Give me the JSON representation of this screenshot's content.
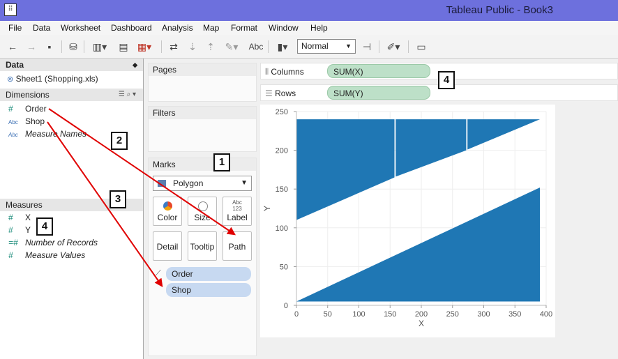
{
  "window": {
    "title": "Tableau Public - Book3"
  },
  "menu": [
    "File",
    "Data",
    "Worksheet",
    "Dashboard",
    "Analysis",
    "Map",
    "Format",
    "Window",
    "Help"
  ],
  "toolbar": {
    "abc_label": "Abc",
    "view_value": "Normal"
  },
  "data_pane": {
    "header": "Data",
    "source": "Sheet1 (Shopping.xls)",
    "dimensions_header": "Dimensions",
    "dimensions": [
      {
        "type": "#",
        "name": "Order"
      },
      {
        "type": "Abc",
        "name": "Shop"
      },
      {
        "type": "Abc",
        "name": "Measure Names"
      }
    ],
    "measures_header": "Measures",
    "measures": [
      {
        "type": "#",
        "name": "X"
      },
      {
        "type": "#",
        "name": "Y"
      },
      {
        "type": "=#",
        "name": "Number of Records"
      },
      {
        "type": "#",
        "name": "Measure Values"
      }
    ]
  },
  "cards": {
    "pages": "Pages",
    "filters": "Filters",
    "marks": "Marks",
    "mark_type": "Polygon",
    "buttons": {
      "color": "Color",
      "size": "Size",
      "label": "Label",
      "label_icon_top": "Abc",
      "label_icon_bottom": "123",
      "detail": "Detail",
      "tooltip": "Tooltip",
      "path": "Path"
    },
    "pills": [
      "Order",
      "Shop"
    ]
  },
  "shelves": {
    "columns_label": "Columns",
    "columns_pill": "SUM(X)",
    "rows_label": "Rows",
    "rows_pill": "SUM(Y)"
  },
  "callouts": [
    "1",
    "2",
    "3",
    "4",
    "4"
  ],
  "colors": {
    "mark": "#1f77b4",
    "pill_measure": "#bde0c8",
    "pill_dimension": "#c7d9f1",
    "arrow": "#e00000"
  },
  "chart_data": {
    "type": "area",
    "mark": "polygon",
    "xlabel": "X",
    "ylabel": "Y",
    "xlim": [
      0,
      400
    ],
    "ylim": [
      0,
      250
    ],
    "xticks": [
      0,
      50,
      100,
      150,
      200,
      250,
      300,
      350,
      400
    ],
    "yticks": [
      0,
      50,
      100,
      150,
      200,
      250
    ],
    "grid": true,
    "polygons": [
      {
        "points": [
          [
            0,
            5
          ],
          [
            390,
            152
          ],
          [
            390,
            5
          ]
        ]
      },
      {
        "points": [
          [
            0,
            110
          ],
          [
            0,
            240
          ],
          [
            157,
            240
          ],
          [
            157,
            165
          ]
        ]
      },
      {
        "points": [
          [
            159,
            166
          ],
          [
            159,
            240
          ],
          [
            272,
            240
          ],
          [
            272,
            200
          ]
        ]
      },
      {
        "points": [
          [
            274,
            201
          ],
          [
            274,
            240
          ],
          [
            390,
            240
          ]
        ]
      }
    ]
  }
}
